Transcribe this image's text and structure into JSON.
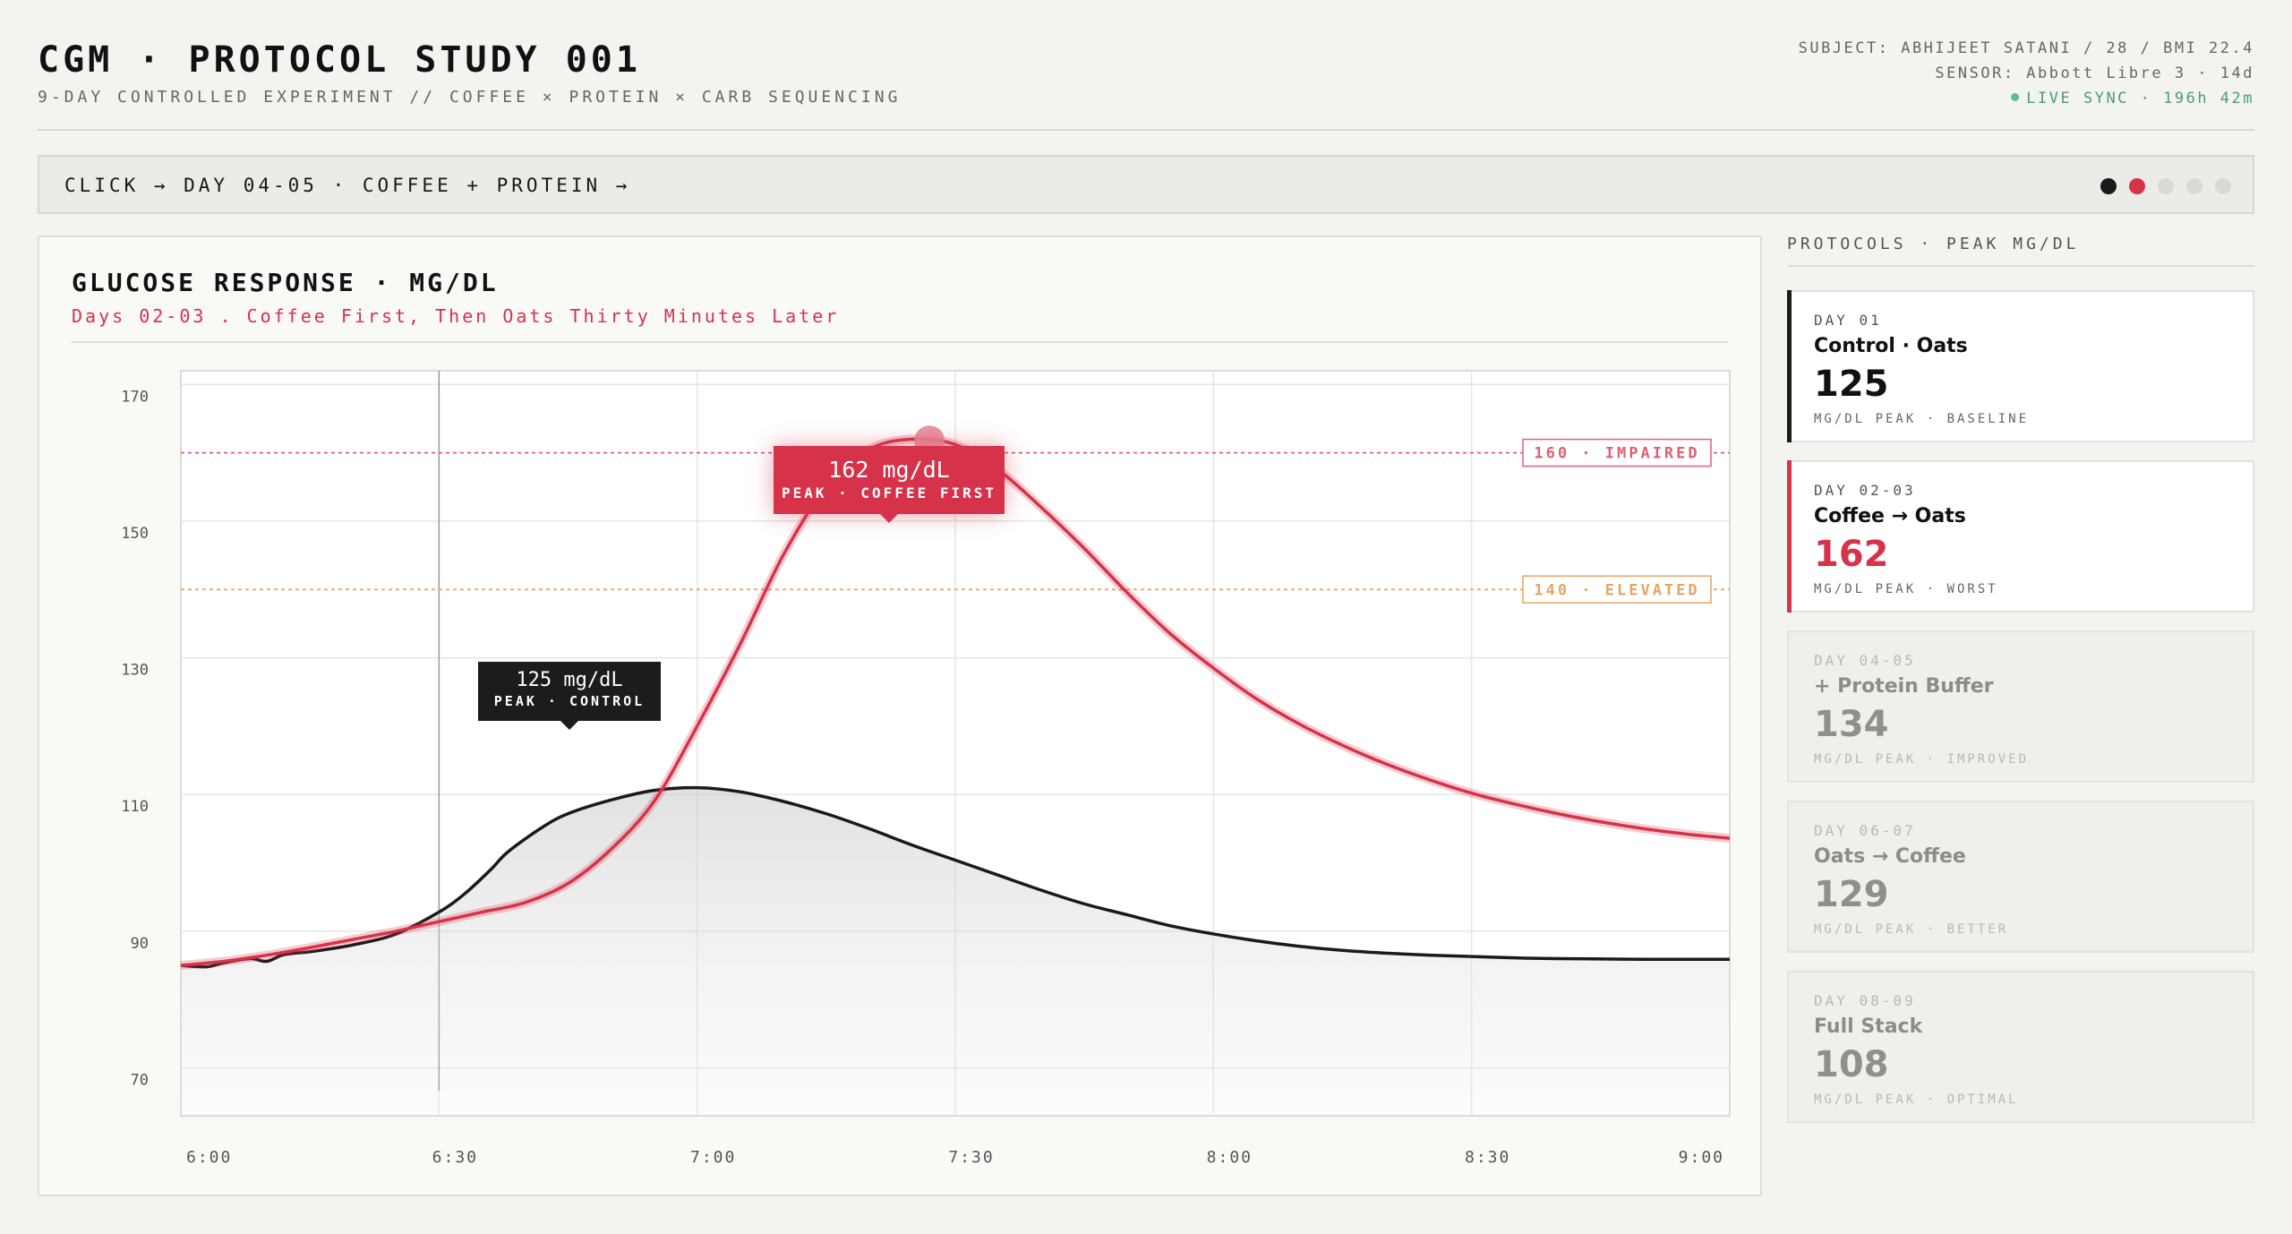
{
  "header": {
    "title": "CGM · PROTOCOL STUDY 001",
    "subtitle": "9-DAY CONTROLLED EXPERIMENT // COFFEE × PROTEIN × CARB SEQUENCING",
    "subject": "SUBJECT: ABHIJEET SATANI / 28 / BMI 22.4",
    "sensor": "SENSOR: Abbott Libre 3 · 14d",
    "live": "LIVE SYNC · 196h 42m"
  },
  "banner": {
    "text": "CLICK → DAY 04-05 · COFFEE + PROTEIN  →",
    "dots": [
      "black",
      "red",
      "grey",
      "grey",
      "grey"
    ]
  },
  "chart_panel": {
    "title": "GLUCOSE RESPONSE · MG/DL",
    "subtitle": "Days 02-03 . Coffee First, Then Oats Thirty Minutes Later"
  },
  "chart_data": {
    "type": "line",
    "title": "GLUCOSE RESPONSE · MG/DL",
    "subtitle": "Days 02-03 . Coffee First, Then Oats Thirty Minutes Later",
    "x_ticks": [
      "6:00",
      "6:30",
      "7:00",
      "7:30",
      "8:00",
      "8:30",
      "9:00"
    ],
    "y_ticks": [
      170,
      150,
      130,
      110,
      90,
      70
    ],
    "ylim": [
      63,
      172
    ],
    "x_minutes_range": [
      0,
      180
    ],
    "grid": true,
    "marker_minute": 30,
    "thresholds": [
      {
        "value": 160,
        "label": "160 · IMPAIRED",
        "color": "#e06075"
      },
      {
        "value": 140,
        "label": "140 · ELEVATED",
        "color": "#e4a563"
      }
    ],
    "series": [
      {
        "color": "#d6334b",
        "points": [
          [
            0,
            85
          ],
          [
            5,
            85.6
          ],
          [
            10,
            86.5
          ],
          [
            15,
            87.6
          ],
          [
            20,
            88.8
          ],
          [
            25,
            90
          ],
          [
            30,
            91.4
          ],
          [
            35,
            92.8
          ],
          [
            40,
            94.2
          ],
          [
            45,
            97
          ],
          [
            50,
            102
          ],
          [
            55,
            109
          ],
          [
            60,
            120
          ],
          [
            65,
            132
          ],
          [
            70,
            145
          ],
          [
            75,
            155
          ],
          [
            80,
            160.5
          ],
          [
            85,
            162
          ],
          [
            90,
            161.2
          ],
          [
            95,
            157.5
          ],
          [
            100,
            152
          ],
          [
            105,
            146
          ],
          [
            110,
            139.5
          ],
          [
            115,
            133.5
          ],
          [
            120,
            128.5
          ],
          [
            125,
            124
          ],
          [
            130,
            120.3
          ],
          [
            135,
            117.2
          ],
          [
            140,
            114.5
          ],
          [
            145,
            112.2
          ],
          [
            150,
            110.2
          ],
          [
            155,
            108.6
          ],
          [
            160,
            107.2
          ],
          [
            165,
            106
          ],
          [
            170,
            105
          ],
          [
            175,
            104.2
          ],
          [
            180,
            103.6
          ]
        ]
      },
      {
        "color": "#1a1a1a",
        "points": [
          [
            0,
            85
          ],
          [
            3,
            84.8
          ],
          [
            5,
            85.4
          ],
          [
            8,
            86
          ],
          [
            10,
            85.6
          ],
          [
            12,
            86.6
          ],
          [
            15,
            87
          ],
          [
            20,
            88
          ],
          [
            25,
            89.6
          ],
          [
            30,
            92.8
          ],
          [
            33,
            95.5
          ],
          [
            36,
            99
          ],
          [
            38,
            101.6
          ],
          [
            42,
            105.2
          ],
          [
            45,
            107.2
          ],
          [
            50,
            109.2
          ],
          [
            55,
            110.6
          ],
          [
            60,
            111
          ],
          [
            65,
            110.4
          ],
          [
            70,
            109
          ],
          [
            75,
            107.2
          ],
          [
            80,
            105
          ],
          [
            85,
            102.6
          ],
          [
            90,
            100.4
          ],
          [
            95,
            98.2
          ],
          [
            100,
            96
          ],
          [
            105,
            94
          ],
          [
            110,
            92.4
          ],
          [
            115,
            90.8
          ],
          [
            120,
            89.6
          ],
          [
            125,
            88.6
          ],
          [
            130,
            87.8
          ],
          [
            135,
            87.2
          ],
          [
            140,
            86.8
          ],
          [
            145,
            86.5
          ],
          [
            150,
            86.3
          ],
          [
            155,
            86.1
          ],
          [
            160,
            86
          ],
          [
            170,
            85.9
          ],
          [
            180,
            85.9
          ]
        ]
      }
    ],
    "annotations": [
      {
        "series": 0,
        "minute": 84,
        "value": 162,
        "text": "162 mg/dL",
        "label": "PEAK · COFFEE FIRST",
        "style": "red"
      },
      {
        "series": 1,
        "minute": 45,
        "value": 125,
        "text": "125 mg/dL",
        "label": "PEAK · CONTROL",
        "style": "black"
      }
    ]
  },
  "sidebar": {
    "heading": "PROTOCOLS · PEAK MG/DL",
    "cards": [
      {
        "day": "DAY 01",
        "name": "Control · Oats",
        "peak": "125",
        "foot": "MG/DL PEAK · BASELINE",
        "state": "active",
        "accent": "#1a1a1a"
      },
      {
        "day": "DAY 02-03",
        "name": "Coffee → Oats",
        "peak": "162",
        "foot": "MG/DL PEAK · WORST",
        "state": "selected",
        "accent": "#d6334b"
      },
      {
        "day": "DAY 04-05",
        "name": "+ Protein Buffer",
        "peak": "134",
        "foot": "MG/DL PEAK · IMPROVED",
        "state": "dim",
        "accent": ""
      },
      {
        "day": "DAY 06-07",
        "name": "Oats → Coffee",
        "peak": "129",
        "foot": "MG/DL PEAK · BETTER",
        "state": "dim",
        "accent": ""
      },
      {
        "day": "DAY 08-09",
        "name": "Full Stack",
        "peak": "108",
        "foot": "MG/DL PEAK · OPTIMAL",
        "state": "dim",
        "accent": ""
      }
    ]
  }
}
